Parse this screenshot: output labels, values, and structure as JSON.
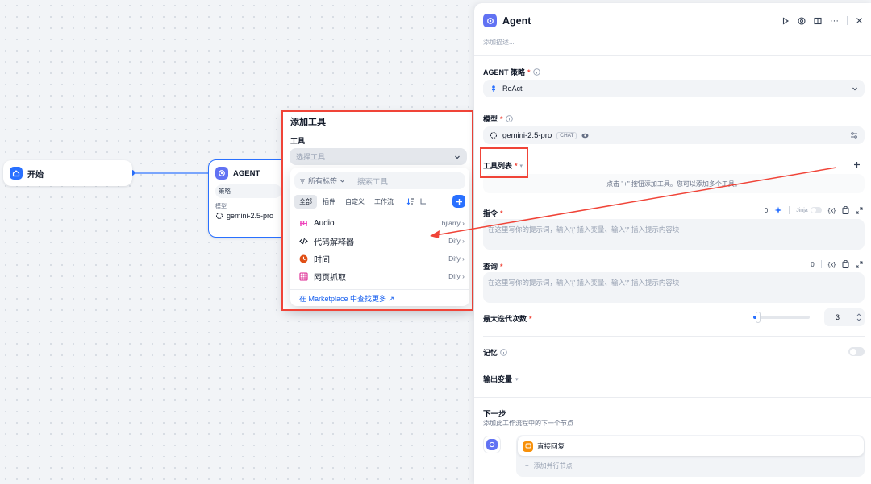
{
  "start_node": {
    "label": "开始"
  },
  "agent_node": {
    "title": "AGENT",
    "strategy_label": "策略",
    "model_label": "模型",
    "model_value": "gemini-2.5-pro"
  },
  "add_tool": {
    "title": "添加工具",
    "tool_label": "工具",
    "select_placeholder": "选择工具",
    "tags_label": "所有标签",
    "search_placeholder": "搜索工具...",
    "tabs": [
      "全部",
      "插件",
      "自定义",
      "工作流"
    ],
    "items": [
      {
        "name": "Audio",
        "provider": "hjlarry",
        "icon": "audio-icon"
      },
      {
        "name": "代码解释器",
        "provider": "Dify",
        "icon": "code-icon"
      },
      {
        "name": "时间",
        "provider": "Dify",
        "icon": "clock-icon"
      },
      {
        "name": "网页抓取",
        "provider": "Dify",
        "icon": "web-scraper-icon"
      }
    ],
    "marketplace_link": "在 Marketplace 中查找更多 ↗"
  },
  "panel": {
    "title": "Agent",
    "description_placeholder": "添加描述...",
    "strategy_label": "AGENT 策略",
    "strategy_value": "ReAct",
    "model_label": "模型",
    "model_value": "gemini-2.5-pro",
    "model_badge": "CHAT",
    "tool_list_label": "工具列表",
    "tool_list_hint": "点击 \"+\" 按钮添加工具。您可以添加多个工具。",
    "instruction_label": "指令",
    "instruction_count": "0",
    "jinja_label": "Jinja",
    "var_label": "{x}",
    "instruction_placeholder": "在这里写你的提示词，输入'{' 插入变量、输入'/' 插入提示内容块",
    "query_label": "查询",
    "query_count": "0",
    "query_placeholder": "在这里写你的提示词，输入'{' 插入变量、输入'/' 插入提示内容块",
    "max_iter_label": "最大迭代次数",
    "max_iter_value": "3",
    "memory_label": "记忆",
    "output_label": "输出变量",
    "next_step_title": "下一步",
    "next_step_desc": "添加此工作流程中的下一个节点",
    "next_node_label": "直接回复",
    "add_parallel_label": "添加并行节点"
  },
  "colors": {
    "accent": "#2970ff",
    "agent": "#6172f3",
    "annotation": "#f04438",
    "reply": "#f79009"
  }
}
